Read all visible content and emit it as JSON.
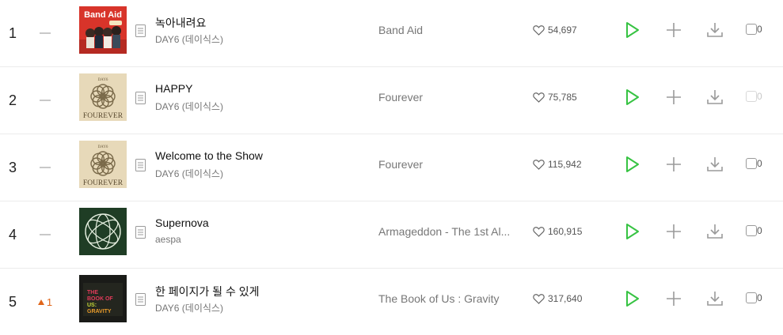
{
  "colors": {
    "accent_green": "#37c343",
    "rank_up": "#e0661b",
    "muted_icon": "#9a9a9a"
  },
  "chart_rows": [
    {
      "rank": "1",
      "change": {
        "type": "same",
        "value": ""
      },
      "title": "녹아내려요",
      "artist": "DAY6 (데이식스)",
      "album": "Band Aid",
      "likes": "54,697",
      "cover": "band-aid",
      "cover_text": "Band Aid",
      "checkbox_count": "0",
      "checkbox_enabled": true
    },
    {
      "rank": "2",
      "change": {
        "type": "same",
        "value": ""
      },
      "title": "HAPPY",
      "artist": "DAY6 (데이식스)",
      "album": "Fourever",
      "likes": "75,785",
      "cover": "fourever",
      "cover_text": "FOUREVER",
      "cover_small_text": "DAY6",
      "checkbox_count": "0",
      "checkbox_enabled": false
    },
    {
      "rank": "3",
      "change": {
        "type": "same",
        "value": ""
      },
      "title": "Welcome to the Show",
      "artist": "DAY6 (데이식스)",
      "album": "Fourever",
      "likes": "115,942",
      "cover": "fourever",
      "cover_text": "FOUREVER",
      "cover_small_text": "DAY6",
      "checkbox_count": "0",
      "checkbox_enabled": true
    },
    {
      "rank": "4",
      "change": {
        "type": "same",
        "value": ""
      },
      "title": "Supernova",
      "artist": "aespa",
      "album": "Armageddon - The 1st Al...",
      "likes": "160,915",
      "cover": "armageddon",
      "checkbox_count": "0",
      "checkbox_enabled": true
    },
    {
      "rank": "5",
      "change": {
        "type": "up",
        "value": "1"
      },
      "title": "한 페이지가 될 수 있게",
      "artist": "DAY6 (데이식스)",
      "album": "The Book of Us : Gravity",
      "likes": "317,640",
      "cover": "gravity",
      "cover_text": "THE BOOK OF US GRAVITY",
      "checkbox_count": "0",
      "checkbox_enabled": true
    }
  ]
}
